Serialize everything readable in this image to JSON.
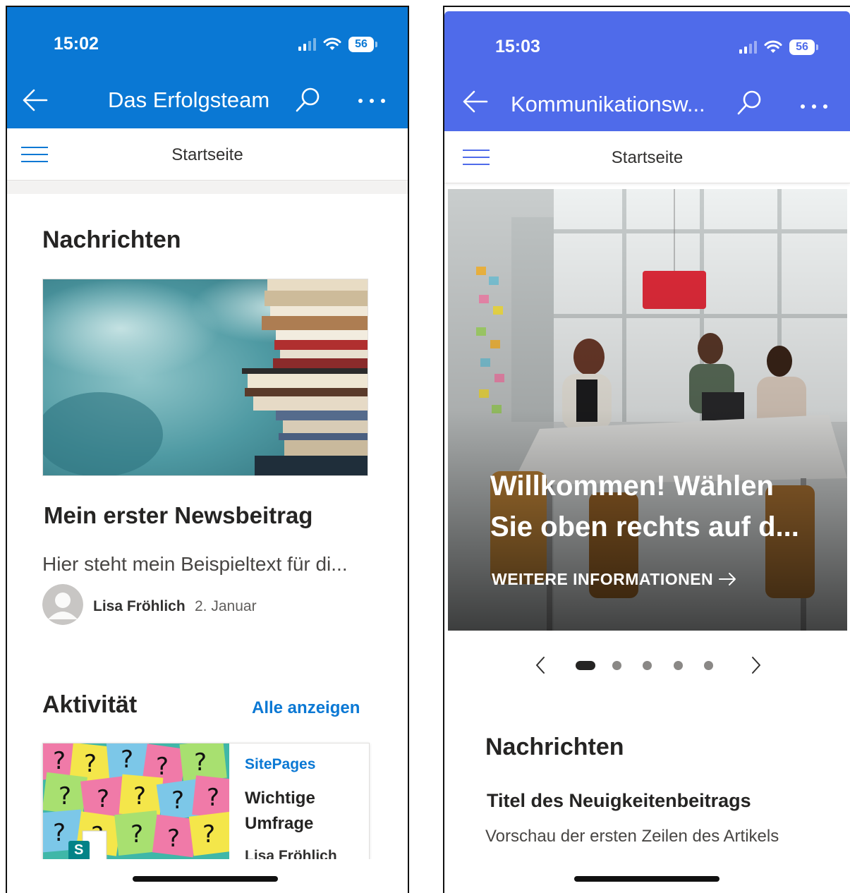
{
  "left_screen": {
    "status": {
      "time": "15:02",
      "battery": "56"
    },
    "header": {
      "title": "Das Erfolgsteam"
    },
    "nav": {
      "label": "Startseite"
    },
    "news": {
      "heading": "Nachrichten",
      "post_title": "Mein erster Newsbeitrag",
      "post_preview": "Hier steht mein Beispieltext für di...",
      "author": "Lisa Fröhlich",
      "date": "2. Januar"
    },
    "activity": {
      "heading": "Aktivität",
      "see_all": "Alle anzeigen",
      "card": {
        "source": "SitePages",
        "title": "Wichtige Umfrage",
        "author": "Lisa Fröhlich",
        "file_badge": "S"
      }
    }
  },
  "right_screen": {
    "status": {
      "time": "15:03",
      "battery": "56"
    },
    "header": {
      "title": "Kommunikationsw..."
    },
    "nav": {
      "label": "Startseite"
    },
    "hero": {
      "text": "Willkommen! Wählen Sie oben rechts auf d...",
      "link": "WEITERE INFORMATIONEN",
      "slide_count": 5,
      "active_slide": 1
    },
    "news": {
      "heading": "Nachrichten",
      "post_title": "Titel des Neuigkeitenbeitrags",
      "post_preview": "Vorschau der ersten Zeilen des Artikels"
    }
  },
  "icons": [
    "back-arrow-icon",
    "search-icon",
    "more-icon",
    "hamburger-icon",
    "signal-icon",
    "wifi-icon",
    "battery-icon",
    "arrow-right-icon",
    "chevron-left-icon",
    "chevron-right-icon"
  ],
  "colors": {
    "left_header": "#0a78d4",
    "right_header": "#4f6bea",
    "link": "#0a78d4"
  }
}
